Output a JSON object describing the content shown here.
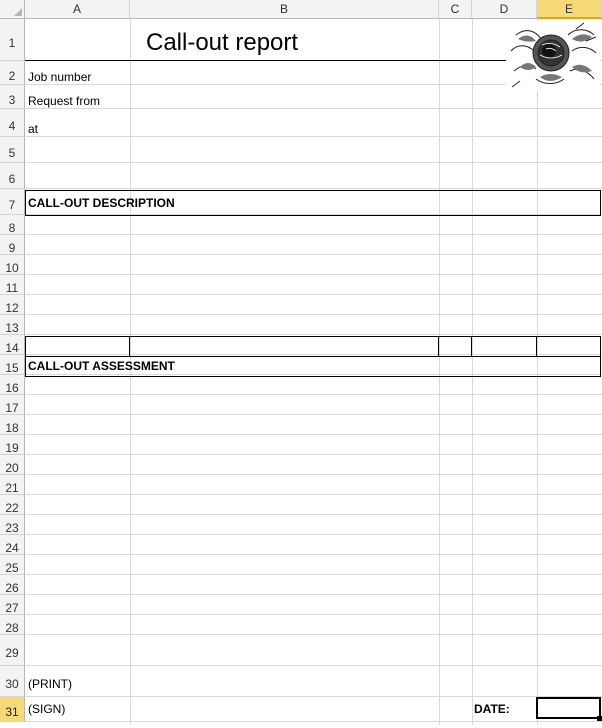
{
  "columns": [
    "A",
    "B",
    "C",
    "D",
    "E"
  ],
  "selected_column": "E",
  "rows": [
    "1",
    "2",
    "3",
    "4",
    "5",
    "6",
    "7",
    "8",
    "9",
    "10",
    "11",
    "12",
    "13",
    "14",
    "15",
    "16",
    "17",
    "18",
    "19",
    "20",
    "21",
    "22",
    "23",
    "24",
    "25",
    "26",
    "27",
    "28",
    "29",
    "30",
    "31"
  ],
  "selected_row": "31",
  "report": {
    "title": "Call-out report",
    "job_number_label": "Job number",
    "request_from_label": "Request from",
    "at_label": "at",
    "description_heading": "CALL-OUT DESCRIPTION",
    "assessment_heading": "CALL-OUT ASSESSMENT",
    "print_label": "(PRINT)",
    "sign_label": "(SIGN)",
    "date_label": "DATE:"
  },
  "logo": {
    "icon": "flower-engraving-image"
  }
}
